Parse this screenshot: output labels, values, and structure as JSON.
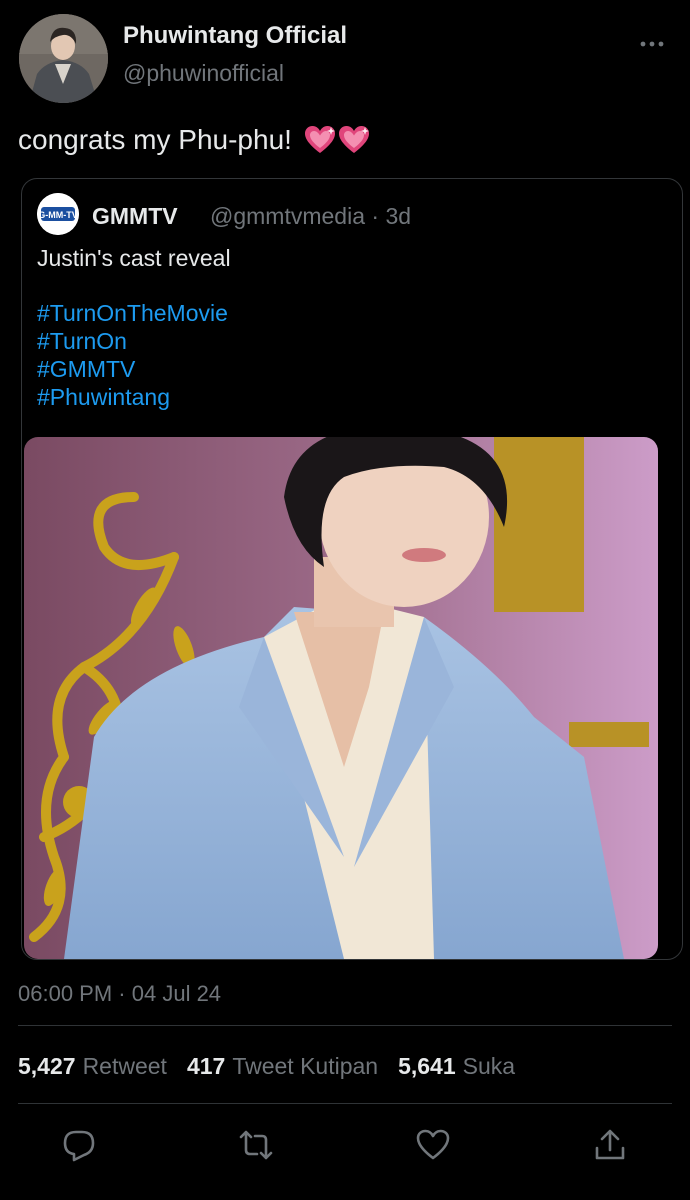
{
  "author": {
    "display_name": "Phuwintang Official",
    "handle": "@phuwinofficial",
    "avatar_icon": "profile-photo"
  },
  "tweet": {
    "text": "congrats my Phu-phu!",
    "emoji_icon": "sparkling-heart-icon"
  },
  "quoted_tweet": {
    "logo_text": "G-MM-TV",
    "name": "GMMTV",
    "handle": "@gmmtvmedia",
    "separator": "·",
    "age": "3d",
    "text": "Justin's cast reveal",
    "hashtags": [
      "#TurnOnTheMovie",
      "#TurnOn",
      "#GMMTV",
      "#Phuwintang"
    ],
    "media_icon": "cast-reveal-photo"
  },
  "meta": {
    "time": "06:00 PM",
    "separator": "·",
    "date": "04 Jul 24"
  },
  "stats": {
    "retweets_count": "5,427",
    "retweets_label": "Retweet",
    "quotes_count": "417",
    "quotes_label": "Tweet Kutipan",
    "likes_count": "5,641",
    "likes_label": "Suka"
  },
  "actions": [
    "reply-icon",
    "retweet-icon",
    "like-icon",
    "share-icon"
  ],
  "colors": {
    "background": "#000000",
    "primary_text": "#e7e9ea",
    "secondary_text": "#71767b",
    "link": "#1d9bf0",
    "heart": "#e0457b"
  }
}
